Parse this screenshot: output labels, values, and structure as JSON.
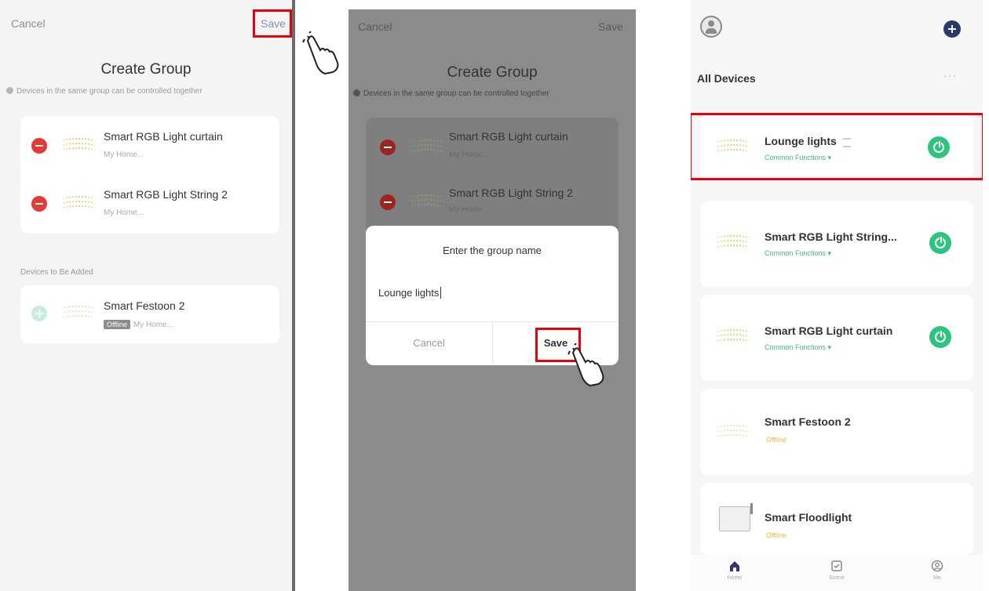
{
  "screen1": {
    "cancel": "Cancel",
    "save": "Save",
    "title": "Create Group",
    "hint": "Devices in the same group can be controlled together",
    "group_devices": [
      {
        "name": "Smart RGB Light curtain",
        "sub": "My Home..."
      },
      {
        "name": "Smart RGB Light String 2",
        "sub": "My Home..."
      }
    ],
    "to_add_label": "Devices to Be Added",
    "to_add": [
      {
        "name": "Smart Festoon 2",
        "status": "Offline",
        "sub": "My Home..."
      }
    ]
  },
  "screen2": {
    "cancel": "Cancel",
    "save": "Save",
    "title": "Create Group",
    "hint": "Devices in the same group can be controlled together",
    "devices": [
      {
        "name": "Smart RGB Light curtain",
        "sub": "My Home..."
      },
      {
        "name": "Smart RGB Light String 2",
        "sub": "My Home..."
      }
    ],
    "dialog": {
      "title": "Enter the group name",
      "value": "Lounge lights",
      "cancel": "Cancel",
      "save": "Save"
    }
  },
  "screen3": {
    "heading": "All Devices",
    "more": "···",
    "devices": [
      {
        "name": "Lounge lights",
        "sub": "Common Functions ▾"
      },
      {
        "name": "Smart RGB Light String...",
        "sub": "Common Functions ▾"
      },
      {
        "name": "Smart RGB Light curtain",
        "sub": "Common Functions ▾"
      },
      {
        "name": "Smart Festoon 2",
        "sub": "Offline"
      },
      {
        "name": "Smart Floodlight",
        "sub": "Offline"
      }
    ],
    "nav": [
      {
        "label": "Home",
        "icon": "home-icon"
      },
      {
        "label": "Scene",
        "icon": "scene-icon"
      },
      {
        "label": "Me",
        "icon": "me-icon"
      }
    ]
  },
  "colors": {
    "highlight": "#e8000b",
    "power_on": "#2cc47e",
    "remove": "#e53935",
    "offline": "#e5b93d"
  }
}
